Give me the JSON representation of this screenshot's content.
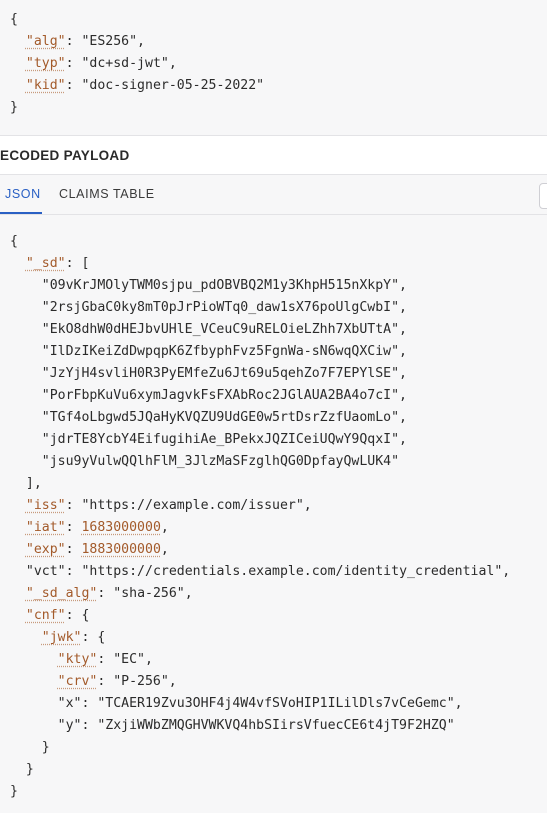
{
  "header_json": {
    "open": "{",
    "close": "}",
    "fields": [
      {
        "key": "\"alg\"",
        "value": "\"ES256\","
      },
      {
        "key": "\"typ\"",
        "value": "\"dc+sd-jwt\","
      },
      {
        "key": "\"kid\"",
        "value": "\"doc-signer-05-25-2022\""
      }
    ]
  },
  "payload_section": {
    "title": "DECODED PAYLOAD",
    "tabs": [
      {
        "label": "JSON",
        "active": true
      },
      {
        "label": "CLAIMS TABLE",
        "active": false
      }
    ]
  },
  "payload_json": {
    "open": "{",
    "sd_key": "\"_sd\"",
    "sd_open": ": [",
    "sd_values": [
      "\"09vKrJMOlyTWM0sjpu_pdOBVBQ2M1y3KhpH515nXkpY\",",
      "\"2rsjGbaC0ky8mT0pJrPioWTq0_daw1sX76poUlgCwbI\",",
      "\"EkO8dhW0dHEJbvUHlE_VCeuC9uRELOieLZhh7XbUTtA\",",
      "\"IlDzIKeiZdDwpqpK6ZfbyphFvz5FgnWa-sN6wqQXCiw\",",
      "\"JzYjH4svliH0R3PyEMfeZu6Jt69u5qehZo7F7EPYlSE\",",
      "\"PorFbpKuVu6xymJagvkFsFXAbRoc2JGlAUA2BA4o7cI\",",
      "\"TGf4oLbgwd5JQaHyKVQZU9UdGE0w5rtDsrZzfUaomLo\",",
      "\"jdrTE8YcbY4EifugihiAe_BPekxJQZICeiUQwY9QqxI\",",
      "\"jsu9yVulwQQlhFlM_3JlzMaSFzglhQG0DpfayQwLUK4\""
    ],
    "sd_close": "],",
    "iss_key": "\"iss\"",
    "iss_value": "\"https://example.com/issuer\",",
    "iat_key": "\"iat\"",
    "iat_value": "1683000000",
    "exp_key": "\"exp\"",
    "exp_value": "1883000000",
    "vct_key": "\"vct\"",
    "vct_value": "\"https://credentials.example.com/identity_credential\",",
    "sd_alg_key": "\"_sd_alg\"",
    "sd_alg_value": "\"sha-256\",",
    "cnf_key": "\"cnf\"",
    "cnf_open": ": {",
    "jwk_key": "\"jwk\"",
    "jwk_open": ": {",
    "jwk_fields": [
      {
        "key": "\"kty\"",
        "value": "\"EC\","
      },
      {
        "key": "\"crv\"",
        "value": "\"P-256\","
      },
      {
        "key": "\"x\"",
        "value": "\"TCAER19Zvu3OHF4j4W4vfSVoHIP1ILilDls7vCeGemc\","
      },
      {
        "key": "\"y\"",
        "value": "\"ZxjiWWbZMQGHVWKVQ4hbSIirsVfuecCE6t4jT9F2HZQ\""
      }
    ],
    "jwk_close": "}",
    "cnf_close": "}",
    "close": "}"
  },
  "colors": {
    "key": "#a35a2a",
    "tab_active": "#2a60c4",
    "background": "#f7f7f8"
  }
}
